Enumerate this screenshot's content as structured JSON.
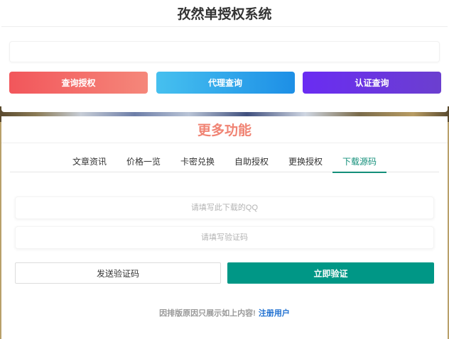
{
  "top": {
    "title": "孜然单授权系统",
    "search": {
      "value": "",
      "placeholder": ""
    },
    "buttons": {
      "query_auth": "查询授权",
      "agent_query": "代理查询",
      "cert_query": "认证查询"
    }
  },
  "more": {
    "title": "更多功能",
    "tabs": [
      {
        "label": "文章资讯"
      },
      {
        "label": "价格一览"
      },
      {
        "label": "卡密兑换"
      },
      {
        "label": "自助授权"
      },
      {
        "label": "更换授权"
      },
      {
        "label": "下载源码",
        "active": true
      }
    ],
    "qq_field": {
      "value": "",
      "placeholder": "请填写此下载的QQ"
    },
    "code_field": {
      "value": "",
      "placeholder": "请填写验证码"
    },
    "send_code": "发送验证码",
    "verify": "立即验证",
    "notice": "因排版原因只展示如上内容!",
    "register_link": "注册用户"
  },
  "colors": {
    "accent_green": "#009786",
    "title_salmon": "#f08474",
    "link_blue": "#1e6fd0"
  }
}
